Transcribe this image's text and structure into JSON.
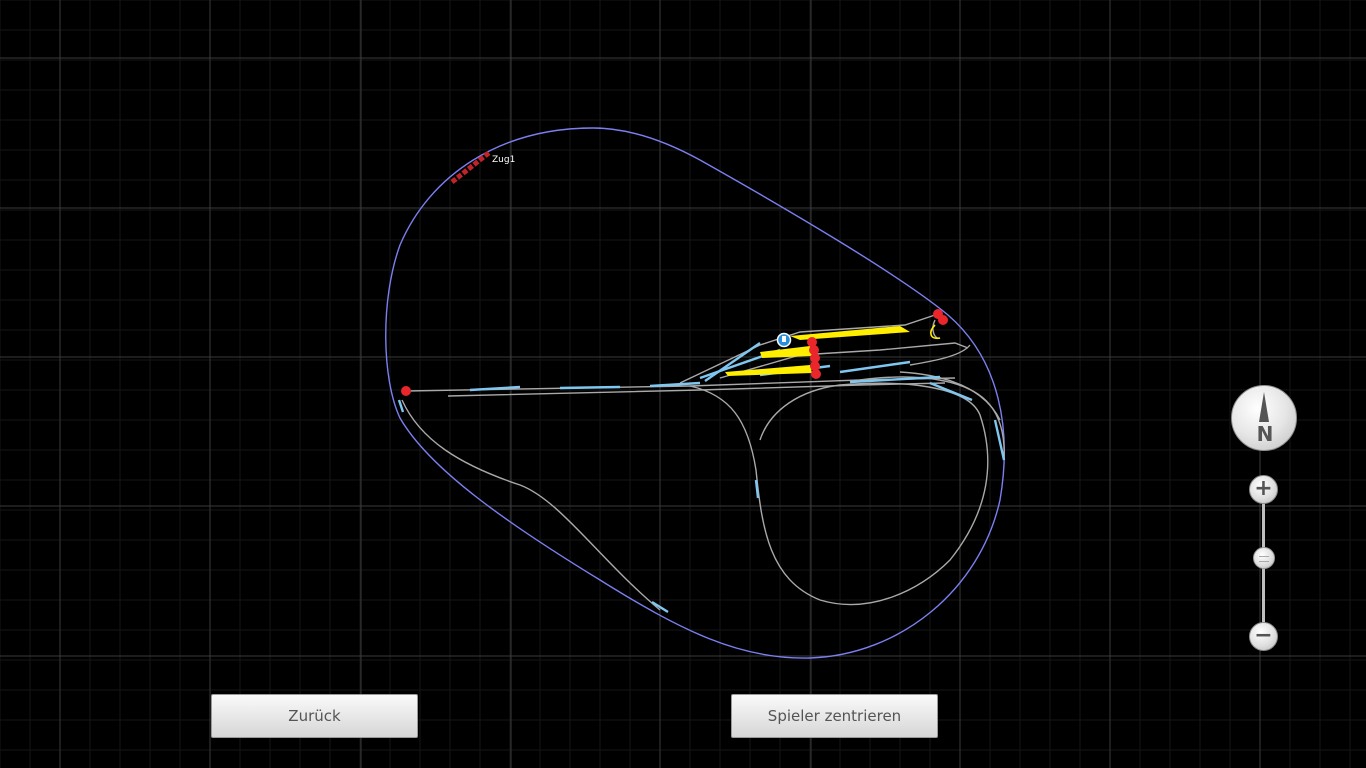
{
  "map": {
    "train_label": "Zug1",
    "colors": {
      "background": "#000000",
      "grid_major": "#3a3a3a",
      "grid_minor": "#161616",
      "main_loop": "#7b7ff0",
      "track": "#a9a9a9",
      "track_highlight": "#7fc7f0",
      "platform": "#ffee00",
      "signal": "#e8262c",
      "train": "#c0242a",
      "player_marker": "#2a8fd8"
    }
  },
  "compass": {
    "label": "N",
    "icon": "north-arrow-icon"
  },
  "zoom": {
    "in_label": "+",
    "out_label": "−",
    "level": 0.55
  },
  "buttons": {
    "back_label": "Zurück",
    "center_player_label": "Spieler zentrieren"
  }
}
